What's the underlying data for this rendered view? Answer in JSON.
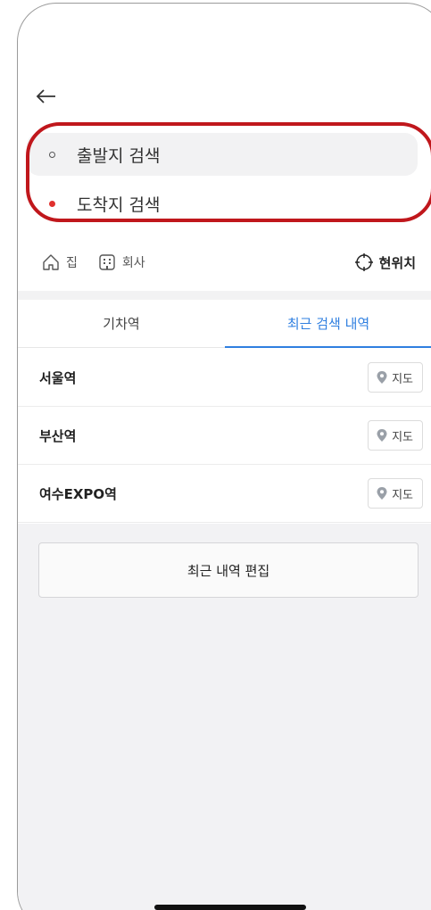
{
  "search": {
    "start_placeholder": "출발지 검색",
    "end_placeholder": "도착지 검색"
  },
  "shortcuts": {
    "home": "집",
    "work": "회사",
    "current_location": "현위치"
  },
  "tabs": [
    {
      "label": "기차역",
      "active": false
    },
    {
      "label": "최근 검색 내역",
      "active": true
    }
  ],
  "recent": [
    {
      "name": "서울역",
      "map_label": "지도"
    },
    {
      "name": "부산역",
      "map_label": "지도"
    },
    {
      "name": "여수EXPO역",
      "map_label": "지도"
    }
  ],
  "edit_label": "최근 내역 편집",
  "colors": {
    "accent": "#2f7fe0",
    "highlight_outline": "#c0171c",
    "end_dot": "#e0312e"
  },
  "icons": {
    "back": "back-arrow-icon",
    "home": "home-icon",
    "work": "building-icon",
    "current_location": "crosshair-icon",
    "map": "map-pin-icon"
  }
}
